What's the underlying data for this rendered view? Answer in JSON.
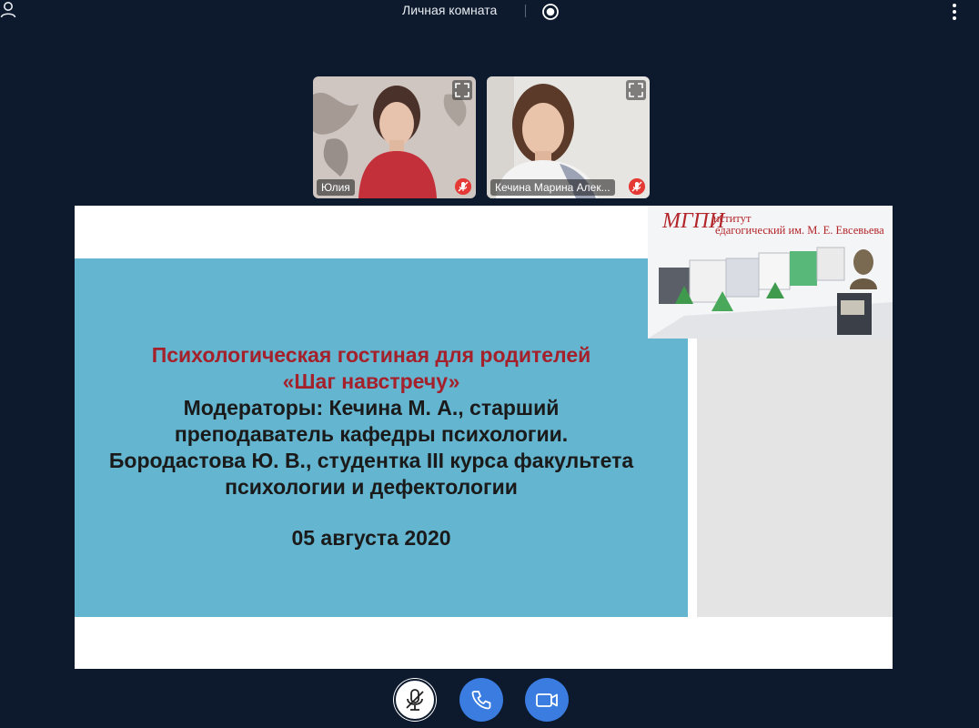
{
  "header": {
    "room_title": "Личная комната",
    "icons": [
      "user-icon",
      "record-icon",
      "more-icon"
    ]
  },
  "participants": [
    {
      "name": "Юлия",
      "muted": true
    },
    {
      "name": "Кечина Марина Алек...",
      "muted": true
    }
  ],
  "slide": {
    "logo_mark": "МГПИ",
    "logo_line1": "нститут",
    "logo_line2": "едагогический им. М. Е. Евсевьева",
    "title_line1": "Психологическая гостиная для родителей",
    "title_line2": "«Шаг навстречу»",
    "body_line1": "Модераторы: Кечина М. А., старший",
    "body_line2": "преподаватель кафедры психологии.",
    "body_line3": "Бородастова Ю. В., студентка III курса факультета",
    "body_line4": "психологии и дефектологии",
    "date": "05 августа 2020"
  },
  "controls": [
    "mic-off-icon",
    "phone-icon",
    "camera-icon"
  ],
  "colors": {
    "background": "#0d1a2d",
    "slide_blue": "#64b5cf",
    "title_red": "#a4212b",
    "button_blue": "#3a7ce0",
    "muted_red": "#e53935"
  }
}
